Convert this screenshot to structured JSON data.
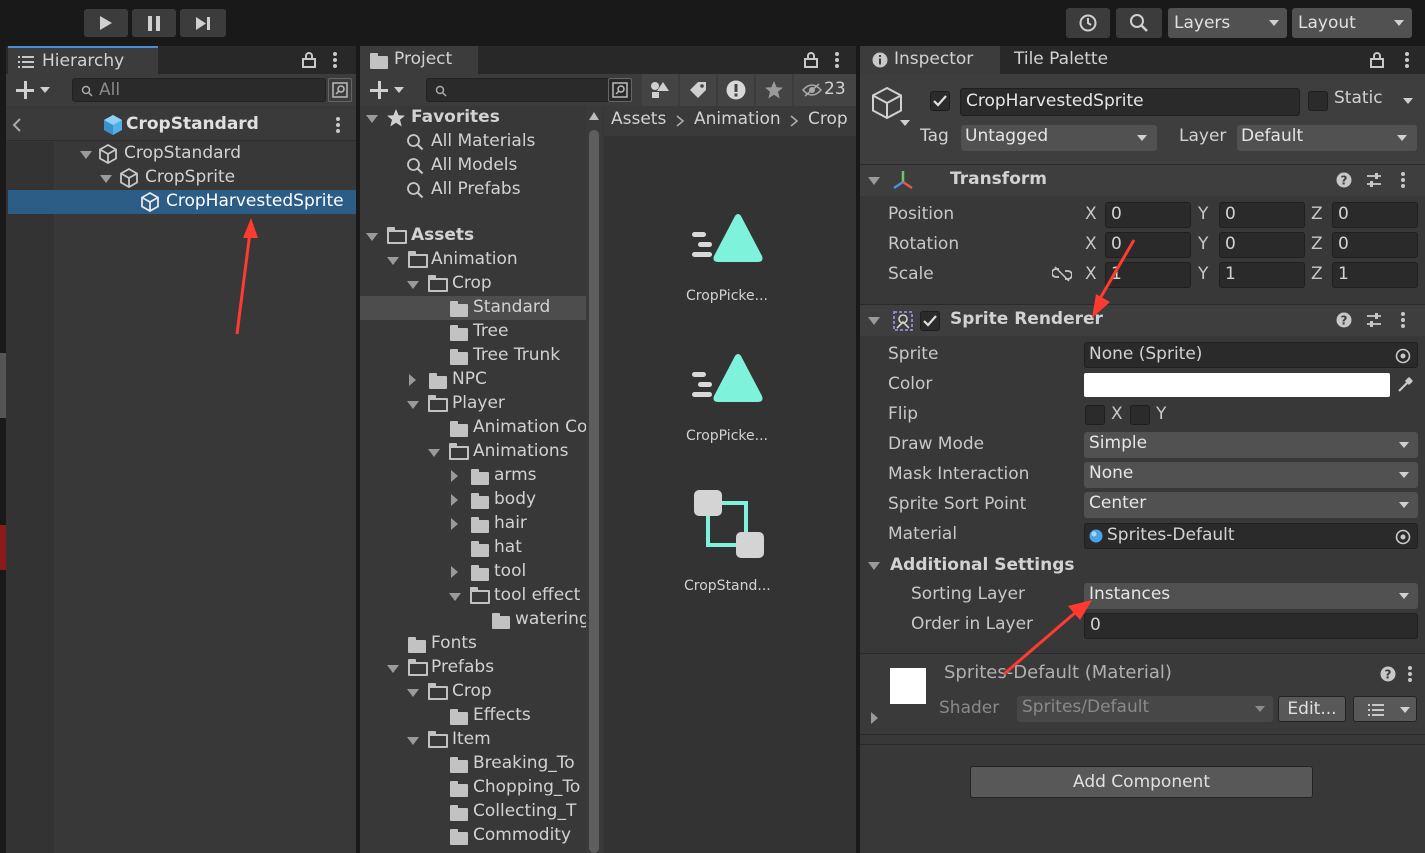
{
  "toolbar": {
    "play_icon": "play-icon",
    "pause_icon": "pause-icon",
    "step_icon": "step-icon",
    "history_icon": "history-icon",
    "search_icon": "search-icon",
    "layers_label": "Layers",
    "layout_label": "Layout"
  },
  "hierarchy": {
    "tab_label": "Hierarchy",
    "search_placeholder": "All",
    "scene_title": "CropStandard",
    "items": [
      {
        "label": "CropStandard"
      },
      {
        "label": "CropSprite"
      },
      {
        "label": "CropHarvestedSprite"
      }
    ]
  },
  "project": {
    "tab_label": "Project",
    "hidden_count": "23",
    "breadcrumb": [
      "Assets",
      "Animation",
      "Crop"
    ],
    "favorites": {
      "label": "Favorites",
      "items": [
        "All Materials",
        "All Models",
        "All Prefabs"
      ]
    },
    "tree": [
      {
        "label": "Assets"
      },
      {
        "label": "Animation"
      },
      {
        "label": "Crop"
      },
      {
        "label": "Standard"
      },
      {
        "label": "Tree"
      },
      {
        "label": "Tree Trunk"
      },
      {
        "label": "NPC"
      },
      {
        "label": "Player"
      },
      {
        "label": "Animation Co"
      },
      {
        "label": "Animations"
      },
      {
        "label": "arms"
      },
      {
        "label": "body"
      },
      {
        "label": "hair"
      },
      {
        "label": "hat"
      },
      {
        "label": "tool"
      },
      {
        "label": "tool effect"
      },
      {
        "label": "watering"
      },
      {
        "label": "Fonts"
      },
      {
        "label": "Prefabs"
      },
      {
        "label": "Crop"
      },
      {
        "label": "Effects"
      },
      {
        "label": "Item"
      },
      {
        "label": "Breaking_To"
      },
      {
        "label": "Chopping_To"
      },
      {
        "label": "Collecting_T"
      },
      {
        "label": "Commodity"
      }
    ],
    "assets": [
      {
        "label": "CropPicke...",
        "icon": "animation-clip-icon"
      },
      {
        "label": "CropPicke...",
        "icon": "animation-clip-icon"
      },
      {
        "label": "CropStand...",
        "icon": "animator-controller-icon"
      }
    ],
    "accent_color": "#7ef2da"
  },
  "inspector": {
    "tab_label": "Inspector",
    "tab2_label": "Tile Palette",
    "object_name": "CropHarvestedSprite",
    "static_label": "Static",
    "tag_label": "Tag",
    "tag_value": "Untagged",
    "layer_label": "Layer",
    "layer_value": "Default",
    "transform": {
      "title": "Transform",
      "position_label": "Position",
      "rotation_label": "Rotation",
      "scale_label": "Scale",
      "axis_x": "X",
      "axis_y": "Y",
      "axis_z": "Z",
      "position": [
        "0",
        "0",
        "0"
      ],
      "rotation": [
        "0",
        "0",
        "0"
      ],
      "scale": [
        "1",
        "1",
        "1"
      ]
    },
    "sprite_renderer": {
      "title": "Sprite Renderer",
      "sprite_label": "Sprite",
      "sprite_value": "None (Sprite)",
      "color_label": "Color",
      "color_value": "#ffffff",
      "flip_label": "Flip",
      "flip_x": "X",
      "flip_y": "Y",
      "draw_mode_label": "Draw Mode",
      "draw_mode_value": "Simple",
      "mask_label": "Mask Interaction",
      "mask_value": "None",
      "sort_point_label": "Sprite Sort Point",
      "sort_point_value": "Center",
      "material_label": "Material",
      "material_value": "Sprites-Default",
      "additional_label": "Additional Settings",
      "sorting_layer_label": "Sorting Layer",
      "sorting_layer_value": "Instances",
      "order_label": "Order in Layer",
      "order_value": "0"
    },
    "material": {
      "title": "Sprites-Default (Material)",
      "shader_label": "Shader",
      "shader_value": "Sprites/Default",
      "edit_label": "Edit..."
    },
    "add_component_label": "Add Component",
    "annotation_color": "#ff3b30"
  }
}
